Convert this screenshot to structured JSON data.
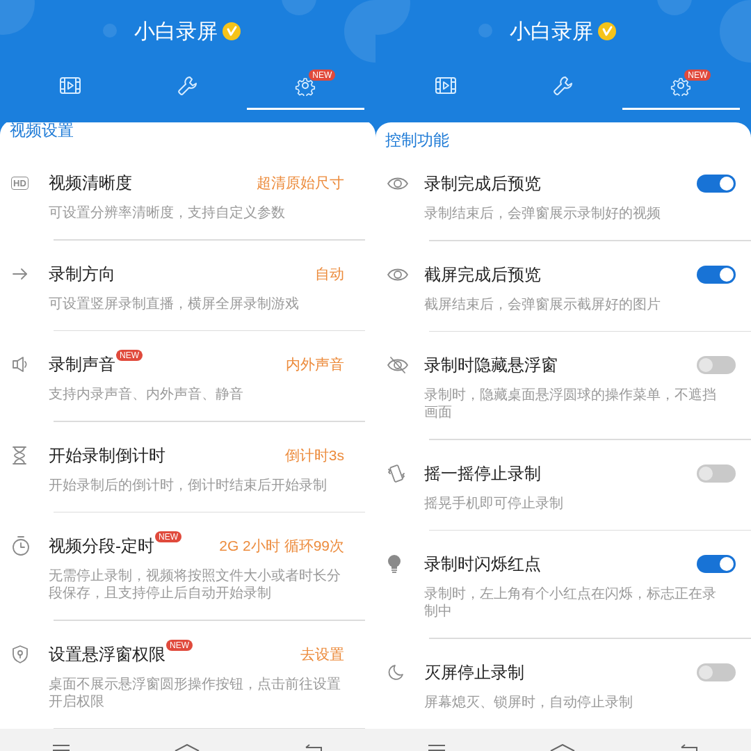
{
  "screens": [
    {
      "title": "小白录屏",
      "tabs": [
        {
          "selected": false
        },
        {
          "selected": false
        },
        {
          "selected": true,
          "badge": "NEW"
        }
      ],
      "section": "视频设置",
      "items": [
        {
          "kind": "value",
          "icon_label": "HD",
          "title": "视频清晰度",
          "value": "超清原始尺寸",
          "desc": "可设置分辨率清晰度，支持自定义参数"
        },
        {
          "kind": "value",
          "title": "录制方向",
          "value": "自动",
          "desc": "可设置竖屏录制直播，横屏全屏录制游戏"
        },
        {
          "kind": "value",
          "title": "录制声音",
          "badge": "NEW",
          "value": "内外声音",
          "desc": "支持内录声音、内外声音、静音"
        },
        {
          "kind": "value",
          "title": "开始录制倒计时",
          "value": "倒计时3s",
          "desc": "开始录制后的倒计时，倒计时结束后开始录制"
        },
        {
          "kind": "value",
          "title": "视频分段-定时",
          "badge": "NEW",
          "value": "2G 2小时 循环99次",
          "desc": "无需停止录制，视频将按照文件大小或者时长分段保存，且支持停止后自动开始录制"
        },
        {
          "kind": "value",
          "title": "设置悬浮窗权限",
          "badge": "NEW",
          "value": "去设置",
          "desc": "桌面不展示悬浮窗圆形操作按钮，点击前往设置开启权限"
        }
      ]
    },
    {
      "title": "小白录屏",
      "tabs": [
        {
          "selected": false
        },
        {
          "selected": false
        },
        {
          "selected": true,
          "badge": "NEW"
        }
      ],
      "section": "控制功能",
      "items": [
        {
          "kind": "toggle",
          "title": "录制完成后预览",
          "on": true,
          "desc": "录制结束后，会弹窗展示录制好的视频"
        },
        {
          "kind": "toggle",
          "title": "截屏完成后预览",
          "on": true,
          "desc": "截屏结束后，会弹窗展示截屏好的图片"
        },
        {
          "kind": "toggle",
          "title": "录制时隐藏悬浮窗",
          "on": false,
          "desc": "录制时，隐藏桌面悬浮圆球的操作菜单，不遮挡画面"
        },
        {
          "kind": "toggle",
          "title": "摇一摇停止录制",
          "on": false,
          "desc": "摇晃手机即可停止录制"
        },
        {
          "kind": "toggle",
          "title": "录制时闪烁红点",
          "on": true,
          "desc": "录制时，左上角有个小红点在闪烁，标志正在录制中"
        },
        {
          "kind": "toggle",
          "title": "灭屏停止录制",
          "on": false,
          "desc": "屏幕熄灭、锁屏时，自动停止录制"
        }
      ]
    }
  ]
}
